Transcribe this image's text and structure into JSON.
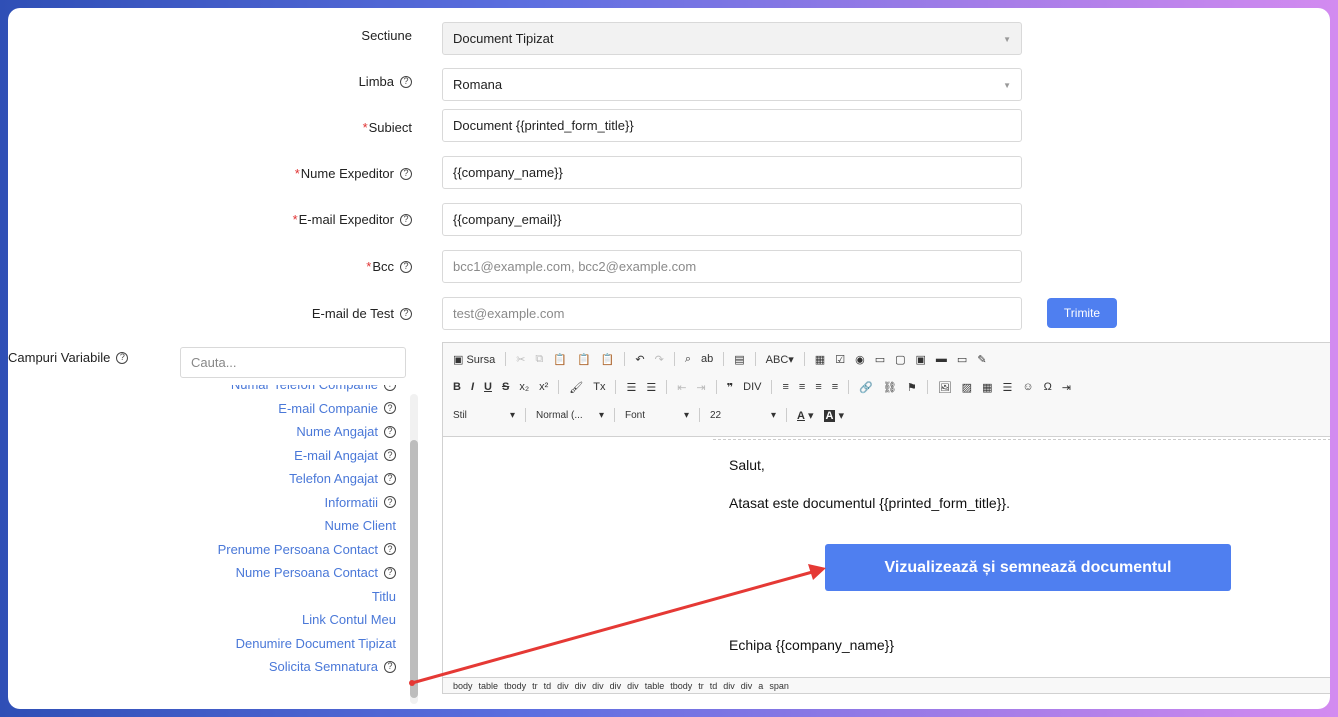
{
  "form": {
    "sectiune": {
      "label": "Sectiune",
      "value": "Document Tipizat"
    },
    "limba": {
      "label": "Limba",
      "value": "Romana"
    },
    "subiect": {
      "required": "*",
      "label": "Subiect",
      "value": "Document {{printed_form_title}}"
    },
    "nume_expeditor": {
      "required": "*",
      "label": "Nume Expeditor",
      "value": "{{company_name}}"
    },
    "email_expeditor": {
      "required": "*",
      "label": "E-mail Expeditor",
      "value": "{{company_email}}"
    },
    "bcc": {
      "required": "*",
      "label": "Bcc",
      "placeholder": "bcc1@example.com, bcc2@example.com"
    },
    "email_test": {
      "label": "E-mail de Test",
      "placeholder": "test@example.com",
      "send_label": "Trimite"
    }
  },
  "variables": {
    "label": "Campuri Variabile",
    "search_placeholder": "Cauta...",
    "items": [
      {
        "label": "Numar Telefon Companie",
        "help": true
      },
      {
        "label": "E-mail Companie",
        "help": true
      },
      {
        "label": "Nume Angajat",
        "help": true
      },
      {
        "label": "E-mail Angajat",
        "help": true
      },
      {
        "label": "Telefon Angajat",
        "help": true
      },
      {
        "label": "Informatii",
        "help": true
      },
      {
        "label": "Nume Client",
        "help": false
      },
      {
        "label": "Prenume Persoana Contact",
        "help": true
      },
      {
        "label": "Nume Persoana Contact",
        "help": true
      },
      {
        "label": "Titlu",
        "help": false
      },
      {
        "label": "Link Contul Meu",
        "help": false
      },
      {
        "label": "Denumire Document Tipizat",
        "help": false
      },
      {
        "label": "Solicita Semnatura",
        "help": true
      }
    ]
  },
  "editor": {
    "toolbar": {
      "source_label": "Sursa",
      "style_label": "Stil",
      "format_label": "Normal (...",
      "font_label": "Font",
      "size_label": "22"
    },
    "content": {
      "greeting": "Salut,",
      "body": "Atasat este documentul {{printed_form_title}}.",
      "button_label": "Vizualizează și semnează documentul",
      "signature": "Echipa {{company_name}}"
    },
    "path": [
      "body",
      "table",
      "tbody",
      "tr",
      "td",
      "div",
      "div",
      "div",
      "div",
      "div",
      "table",
      "tbody",
      "tr",
      "td",
      "div",
      "div",
      "a",
      "span"
    ]
  },
  "colors": {
    "accent": "#4f7ff0",
    "link": "#4a78d8",
    "required": "#e03131",
    "annotation_arrow": "#e53935"
  }
}
